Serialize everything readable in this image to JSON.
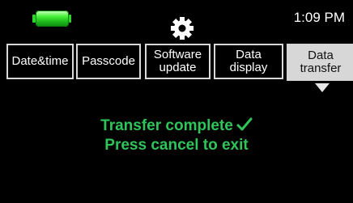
{
  "status_bar": {
    "battery_icon": "battery-full-icon",
    "settings_icon": "gear-icon",
    "time": "1:09 PM",
    "colors": {
      "battery": "#2bd52b"
    }
  },
  "tabs": [
    {
      "label": "Date&time"
    },
    {
      "label": "Passcode"
    },
    {
      "label": "Software\nupdate"
    },
    {
      "label": "Data\ndisplay"
    },
    {
      "label": "Data\ntransfer",
      "selected": true
    }
  ],
  "message": {
    "line1": "Transfer complete",
    "line2": "Press cancel to exit",
    "icon": "checkmark-icon",
    "color": "#2fc55a"
  }
}
